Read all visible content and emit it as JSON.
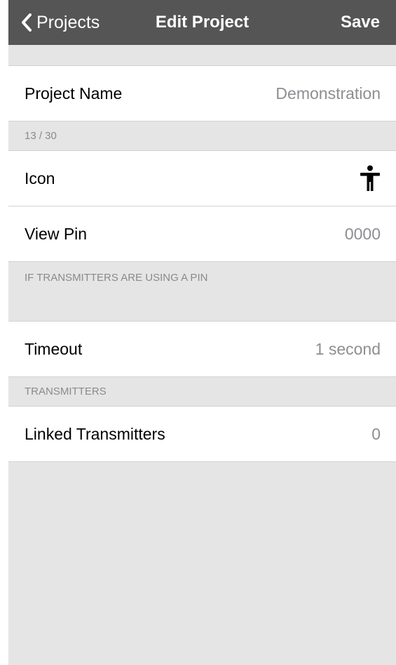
{
  "navbar": {
    "back_label": "Projects",
    "title": "Edit Project",
    "save_label": "Save"
  },
  "project_name": {
    "label": "Project Name",
    "value": "Demonstration",
    "counter": "13 / 30"
  },
  "icon_row": {
    "label": "Icon",
    "icon": "accessibility-person-icon"
  },
  "view_pin": {
    "label": "View Pin",
    "value": "0000",
    "footer": "IF TRANSMITTERS ARE USING A PIN"
  },
  "timeout": {
    "label": "Timeout",
    "value": "1 second"
  },
  "transmitters": {
    "header": "TRANSMITTERS",
    "label": "Linked Transmitters",
    "value": "0"
  },
  "colors": {
    "navbar": "#555555",
    "background": "#e5e5e5",
    "value_text": "#8e8e93"
  }
}
